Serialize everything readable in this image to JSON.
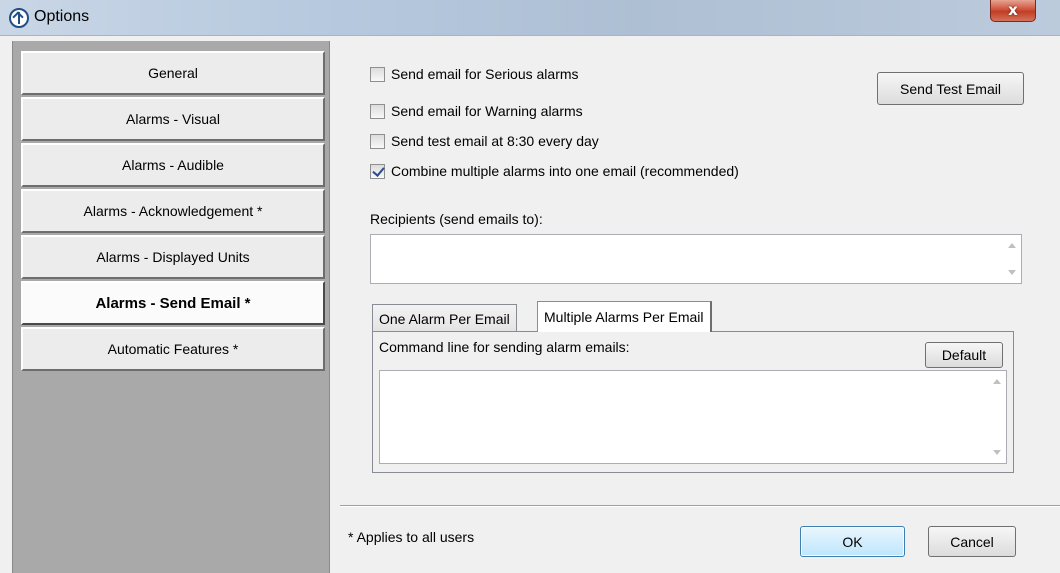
{
  "window": {
    "title": "Options",
    "close_glyph": "x",
    "app_icon": "app-arrow-icon",
    "close_icon": "close-icon"
  },
  "sidebar": {
    "items": [
      {
        "label": "General",
        "active": false
      },
      {
        "label": "Alarms - Visual",
        "active": false
      },
      {
        "label": "Alarms - Audible",
        "active": false
      },
      {
        "label": "Alarms - Acknowledgement *",
        "active": false
      },
      {
        "label": "Alarms - Displayed Units",
        "active": false
      },
      {
        "label": "Alarms - Send Email *",
        "active": true
      },
      {
        "label": "Automatic Features *",
        "active": false
      }
    ]
  },
  "options": {
    "serious": {
      "label": "Send email for Serious alarms",
      "checked": false
    },
    "warning": {
      "label": "Send email for Warning alarms",
      "checked": false
    },
    "daily": {
      "label": "Send test email at 8:30 every day",
      "checked": false
    },
    "combine": {
      "label": "Combine multiple alarms into one email (recommended)",
      "checked": true
    }
  },
  "send_test_label": "Send Test Email",
  "recipients": {
    "label": "Recipients (send emails to):",
    "value": ""
  },
  "tabs": [
    {
      "label": "One Alarm Per Email",
      "active": false
    },
    {
      "label": "Multiple Alarms Per Email",
      "active": true
    }
  ],
  "command": {
    "label": "Command line for sending alarm emails:",
    "default_label": "Default",
    "value": ""
  },
  "footer": {
    "note": "* Applies to all users",
    "ok_label": "OK",
    "cancel_label": "Cancel"
  },
  "colors": {
    "sidebar_bg": "#a9a9a9",
    "dialog_bg": "#f0f0f0",
    "close_red": "#c13d24",
    "check_blue": "#2b4c8c"
  }
}
